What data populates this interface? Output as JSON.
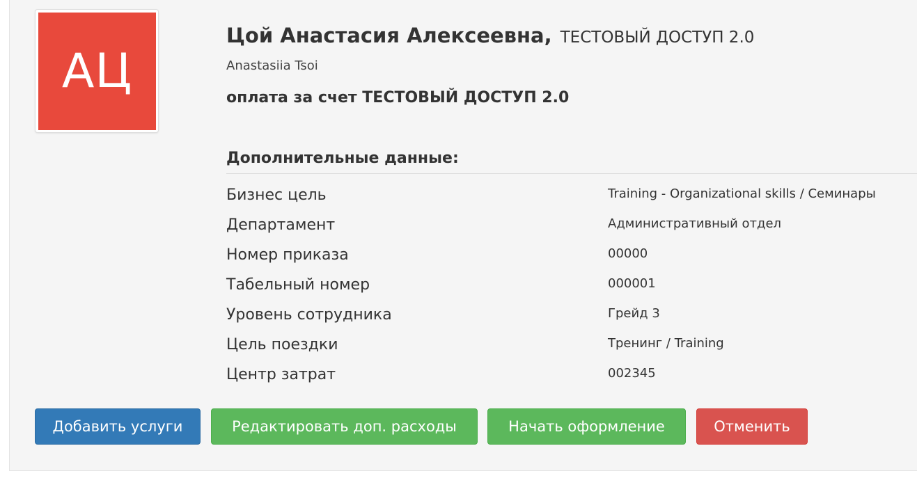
{
  "profile": {
    "initials": "АЦ",
    "name": "Цой Анастасия Алексеевна,",
    "company": "ТЕСТОВЫЙ ДОСТУП 2.0",
    "latin_name": "Anastasiia Tsoi",
    "payment": "оплата за счет ТЕСТОВЫЙ ДОСТУП 2.0",
    "avatar_color": "#e8493c"
  },
  "details": {
    "title": "Дополнительные данные:",
    "rows": [
      {
        "label": "Бизнес цель",
        "value": "Training - Organizational skills / Семинары"
      },
      {
        "label": "Департамент",
        "value": "Административный отдел"
      },
      {
        "label": "Номер приказа",
        "value": "00000"
      },
      {
        "label": "Табельный номер",
        "value": "000001"
      },
      {
        "label": "Уровень сотрудника",
        "value": "Грейд 3"
      },
      {
        "label": "Цель поездки",
        "value": "Тренинг / Training"
      },
      {
        "label": "Центр затрат",
        "value": "002345"
      }
    ]
  },
  "actions": {
    "add_services": "Добавить услуги",
    "edit_expenses": "Редактировать доп. расходы",
    "start_booking": "Начать оформление",
    "cancel": "Отменить",
    "colors": {
      "primary": "#337ab7",
      "success": "#5cb85c",
      "danger": "#d9534f"
    }
  }
}
